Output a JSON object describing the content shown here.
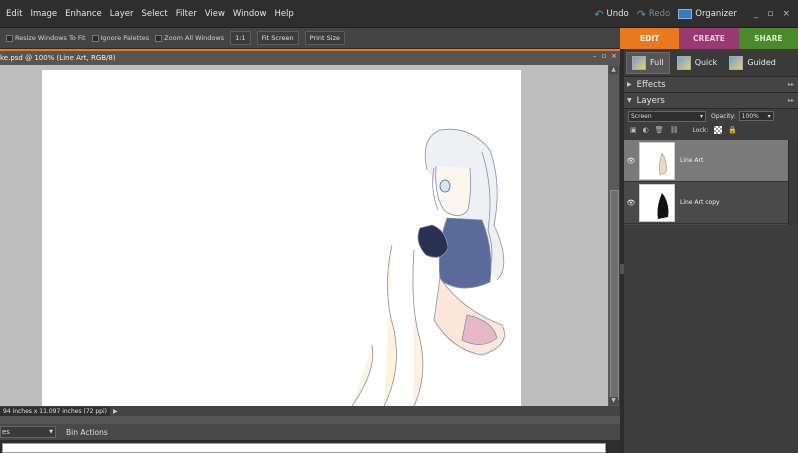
{
  "menu": [
    "Edit",
    "Image",
    "Enhance",
    "Layer",
    "Select",
    "Filter",
    "View",
    "Window",
    "Help"
  ],
  "topright": {
    "undo": "Undo",
    "redo": "Redo",
    "organizer": "Organizer",
    "minimize": "_",
    "restore": "▫",
    "close": "×"
  },
  "options": {
    "resize": "Resize Windows To Fit",
    "ignore": "Ignore Palettes",
    "zoomall": "Zoom All Windows",
    "one_to_one": "1:1",
    "fit_screen": "Fit Screen",
    "print_size": "Print Size"
  },
  "modes": {
    "edit": "EDIT",
    "create": "CREATE",
    "share": "SHARE",
    "edit_color": "#e8791e",
    "create_color": "#9a3a72",
    "share_color": "#4a8a2a"
  },
  "document": {
    "title": "ke.psd @ 100% (Line Art, RGB/8)",
    "status": "94 inches x 11.097 inches (72 ppi)"
  },
  "bin": {
    "select": "es",
    "actions": "Bin Actions"
  },
  "panel": {
    "tabs": {
      "full": "Full",
      "quick": "Quick",
      "guided": "Guided"
    },
    "effects": "Effects",
    "layers": "Layers",
    "blend_mode": "Screen",
    "opacity_label": "Opacity:",
    "opacity_value": "100%",
    "lock_label": "Lock:",
    "layer_list": [
      {
        "name": "Line Art",
        "selected": true
      },
      {
        "name": "Line Art copy",
        "selected": false
      }
    ]
  }
}
